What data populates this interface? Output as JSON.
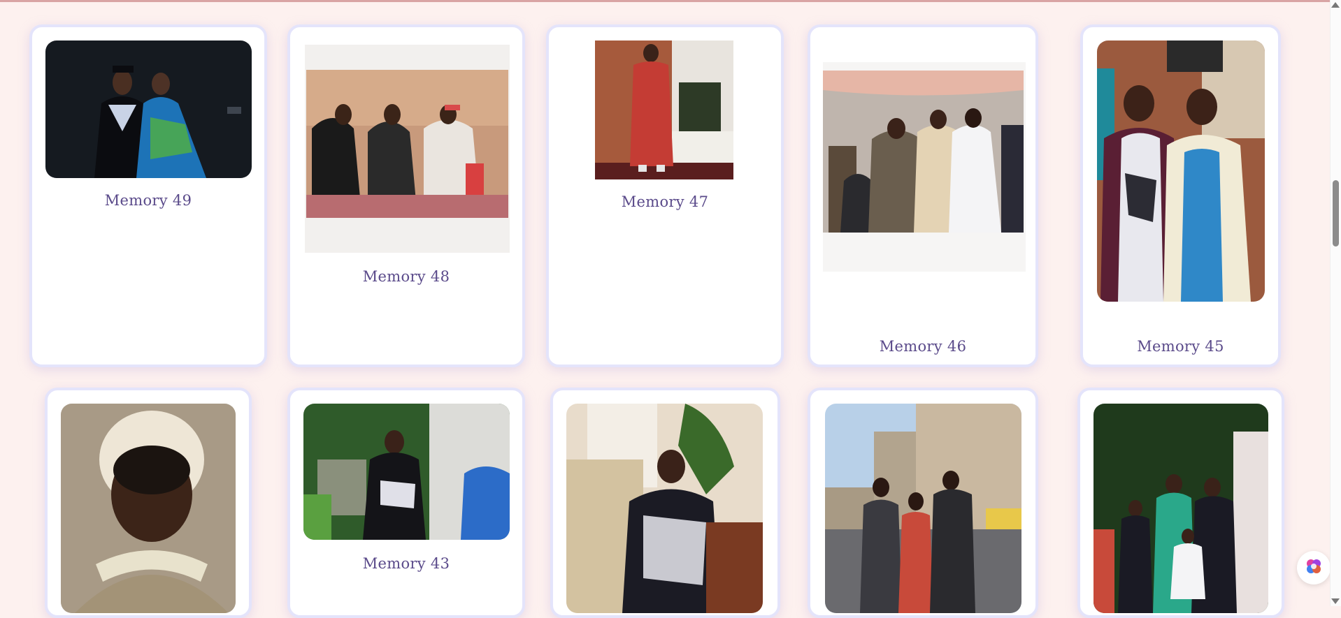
{
  "gallery": {
    "cards": [
      {
        "label": "Memory 49"
      },
      {
        "label": "Memory 48"
      },
      {
        "label": "Memory 47"
      },
      {
        "label": "Memory 46"
      },
      {
        "label": "Memory 45"
      },
      {
        "label": ""
      },
      {
        "label": "Memory 43"
      },
      {
        "label": ""
      },
      {
        "label": ""
      },
      {
        "label": ""
      }
    ]
  },
  "colors": {
    "background": "#fdf1ef",
    "card_border": "#e4e4fb",
    "label_text": "#5a4a8a",
    "scroll_thumb": "#8c8c8c"
  },
  "icons": {
    "assistant_button": "brain-icon"
  }
}
